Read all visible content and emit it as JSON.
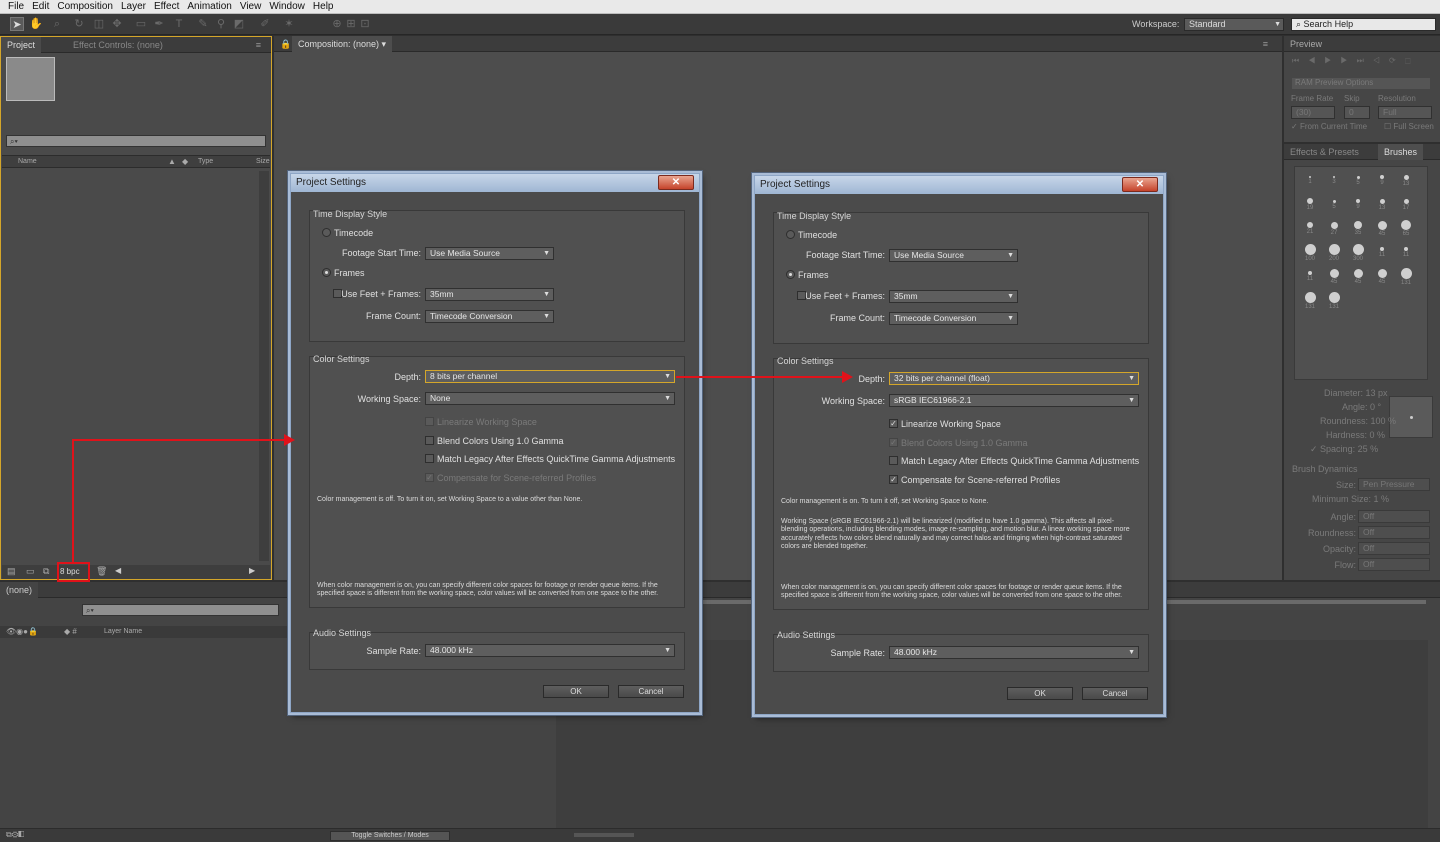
{
  "menu": [
    "File",
    "Edit",
    "Composition",
    "Layer",
    "Effect",
    "Animation",
    "View",
    "Window",
    "Help"
  ],
  "toolbar": {
    "workspace_label": "Workspace:",
    "workspace_value": "Standard",
    "search_placeholder": "Search Help"
  },
  "project_panel": {
    "tab_project": "Project",
    "tab_effect_controls": "Effect Controls: (none)",
    "col_name": "Name",
    "col_type": "Type",
    "col_size": "Size",
    "bpc": "8 bpc"
  },
  "composition_panel": {
    "tab": "Composition: (none)"
  },
  "timeline": {
    "tab": "(none)",
    "col_layer_name": "Layer Name",
    "toggle": "Toggle Switches / Modes"
  },
  "preview_panel": {
    "tab": "Preview",
    "ram": "RAM Preview Options",
    "frame_rate": "Frame Rate",
    "skip": "Skip",
    "resolution": "Resolution",
    "auto": "(30)",
    "skip_val": "0",
    "res_val": "Full",
    "from_current": "From Current Time",
    "full_screen": "Full Screen"
  },
  "effects_panel": {
    "tab_effects": "Effects & Presets",
    "tab_brushes": "Brushes",
    "brush_sizes": [
      "1",
      "3",
      "5",
      "9",
      "13",
      "19",
      "5",
      "9",
      "13",
      "17",
      "21",
      "27",
      "35",
      "45",
      "65",
      "100",
      "200",
      "300",
      "11",
      "11",
      "11",
      "45",
      "45",
      "45",
      "131",
      "131",
      "131"
    ],
    "diameter": "Diameter: 13 px",
    "angle": "Angle: 0 °",
    "roundness": "Roundness: 100 %",
    "hardness": "Hardness: 0 %",
    "spacing": "Spacing: 25 %",
    "brush_dynamics": "Brush Dynamics",
    "size": "Size:",
    "size_val": "Pen Pressure",
    "min_size": "Minimum Size: 1 %",
    "dyn_angle": "Angle:",
    "dyn_roundness": "Roundness:",
    "opacity": "Opacity:",
    "flow": "Flow:",
    "off": "Off"
  },
  "dialogs": [
    {
      "title": "Project Settings",
      "time_display": "Time Display Style",
      "timecode": "Timecode",
      "footage_start": "Footage Start Time:",
      "footage_start_val": "Use Media Source",
      "frames": "Frames",
      "use_feet": "Use Feet + Frames:",
      "feet_val": "35mm",
      "frame_count": "Frame Count:",
      "frame_count_val": "Timecode Conversion",
      "color_settings": "Color Settings",
      "depth": "Depth:",
      "depth_val": "8 bits per channel",
      "working_space": "Working Space:",
      "working_space_val": "None",
      "linearize": "Linearize Working Space",
      "blend": "Blend Colors Using 1.0 Gamma",
      "match_legacy": "Match Legacy After Effects QuickTime Gamma Adjustments",
      "compensate": "Compensate for Scene-referred Profiles",
      "note1": "Color management is off. To turn it on, set Working Space to a value other than None.",
      "note2": "",
      "note3": "When color management is on, you can specify different color spaces for footage or render queue items. If the specified space is different from the working space, color values will be converted from one space to the other.",
      "audio": "Audio Settings",
      "sample_rate": "Sample Rate:",
      "sample_rate_val": "48.000 kHz",
      "ok": "OK",
      "cancel": "Cancel"
    },
    {
      "title": "Project Settings",
      "time_display": "Time Display Style",
      "timecode": "Timecode",
      "footage_start": "Footage Start Time:",
      "footage_start_val": "Use Media Source",
      "frames": "Frames",
      "use_feet": "Use Feet + Frames:",
      "feet_val": "35mm",
      "frame_count": "Frame Count:",
      "frame_count_val": "Timecode Conversion",
      "color_settings": "Color Settings",
      "depth": "Depth:",
      "depth_val": "32 bits per channel (float)",
      "working_space": "Working Space:",
      "working_space_val": "sRGB IEC61966-2.1",
      "linearize": "Linearize Working Space",
      "blend": "Blend Colors Using 1.0 Gamma",
      "match_legacy": "Match Legacy After Effects QuickTime Gamma Adjustments",
      "compensate": "Compensate for Scene-referred Profiles",
      "note1": "Color management is on. To turn it off, set Working Space to None.",
      "note2": "Working Space (sRGB IEC61966-2.1) will be linearized (modified to have 1.0 gamma). This affects all pixel-blending operations, including blending modes, image re-sampling, and motion blur. A linear working space more accurately reflects how colors blend naturally and may correct halos and fringing when high-contrast saturated colors are blended together.",
      "note3": "When color management is on, you can specify different color spaces for footage or render queue items. If the specified space is different from the working space, color values will be converted from one space to the other.",
      "audio": "Audio Settings",
      "sample_rate": "Sample Rate:",
      "sample_rate_val": "48.000 kHz",
      "ok": "OK",
      "cancel": "Cancel"
    }
  ],
  "colors": {
    "annotation": "#e0121a",
    "focus_border": "#d4a62a",
    "panel": "#4a4a4a"
  }
}
